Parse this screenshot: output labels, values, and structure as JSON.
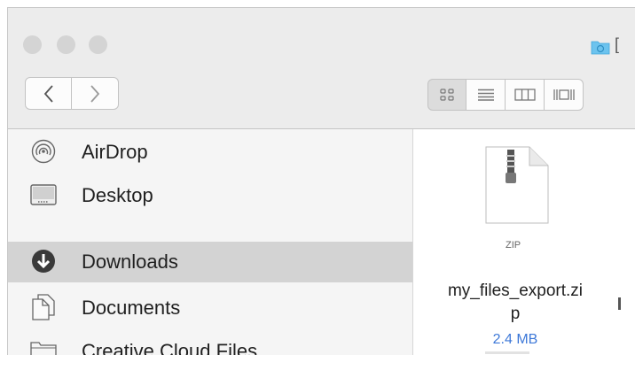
{
  "window": {
    "title_partial": "["
  },
  "toolbar": {
    "back_label": "<",
    "forward_label": ">",
    "views": [
      "icon-view",
      "list-view",
      "column-view",
      "cover-flow-view"
    ]
  },
  "sidebar": {
    "items": [
      {
        "label": "AirDrop",
        "icon": "airdrop-icon"
      },
      {
        "label": "Desktop",
        "icon": "desktop-icon"
      },
      {
        "label": "Downloads",
        "icon": "downloads-icon",
        "selected": true
      },
      {
        "label": "Documents",
        "icon": "documents-icon"
      },
      {
        "label": "Creative Cloud Files",
        "icon": "folder-icon"
      }
    ]
  },
  "content": {
    "file": {
      "name_line1": "my_files_export.zi",
      "name_line2": "p",
      "size": "2.4 MB",
      "type_label": "ZIP"
    }
  },
  "colors": {
    "selection": "#d3d3d3",
    "size_text": "#3d78d8",
    "toolbar": "#ececec"
  }
}
